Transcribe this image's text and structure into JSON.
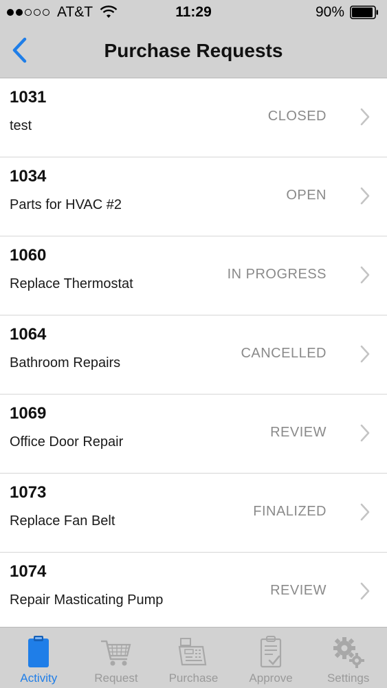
{
  "status_bar": {
    "carrier": "AT&T",
    "time": "11:29",
    "battery": "90%"
  },
  "nav": {
    "title": "Purchase Requests"
  },
  "requests": [
    {
      "id": "1031",
      "description": "test",
      "status": "CLOSED"
    },
    {
      "id": "1034",
      "description": "Parts for HVAC #2",
      "status": "OPEN"
    },
    {
      "id": "1060",
      "description": "Replace Thermostat",
      "status": "IN PROGRESS"
    },
    {
      "id": "1064",
      "description": "Bathroom Repairs",
      "status": "CANCELLED"
    },
    {
      "id": "1069",
      "description": "Office Door Repair",
      "status": "REVIEW"
    },
    {
      "id": "1073",
      "description": "Replace Fan Belt",
      "status": "FINALIZED"
    },
    {
      "id": "1074",
      "description": "Repair Masticating Pump",
      "status": "REVIEW"
    }
  ],
  "tabs": [
    {
      "label": "Activity",
      "icon": "clipboard-icon",
      "active": true
    },
    {
      "label": "Request",
      "icon": "shopping-cart-icon",
      "active": false
    },
    {
      "label": "Purchase",
      "icon": "cash-register-icon",
      "active": false
    },
    {
      "label": "Approve",
      "icon": "checklist-icon",
      "active": false
    },
    {
      "label": "Settings",
      "icon": "gears-icon",
      "active": false
    }
  ],
  "colors": {
    "accent": "#1f7ee8",
    "bar_background": "#d2d2d2",
    "status_text": "#8a8a8a",
    "inactive_tab": "#9a9a9a"
  }
}
